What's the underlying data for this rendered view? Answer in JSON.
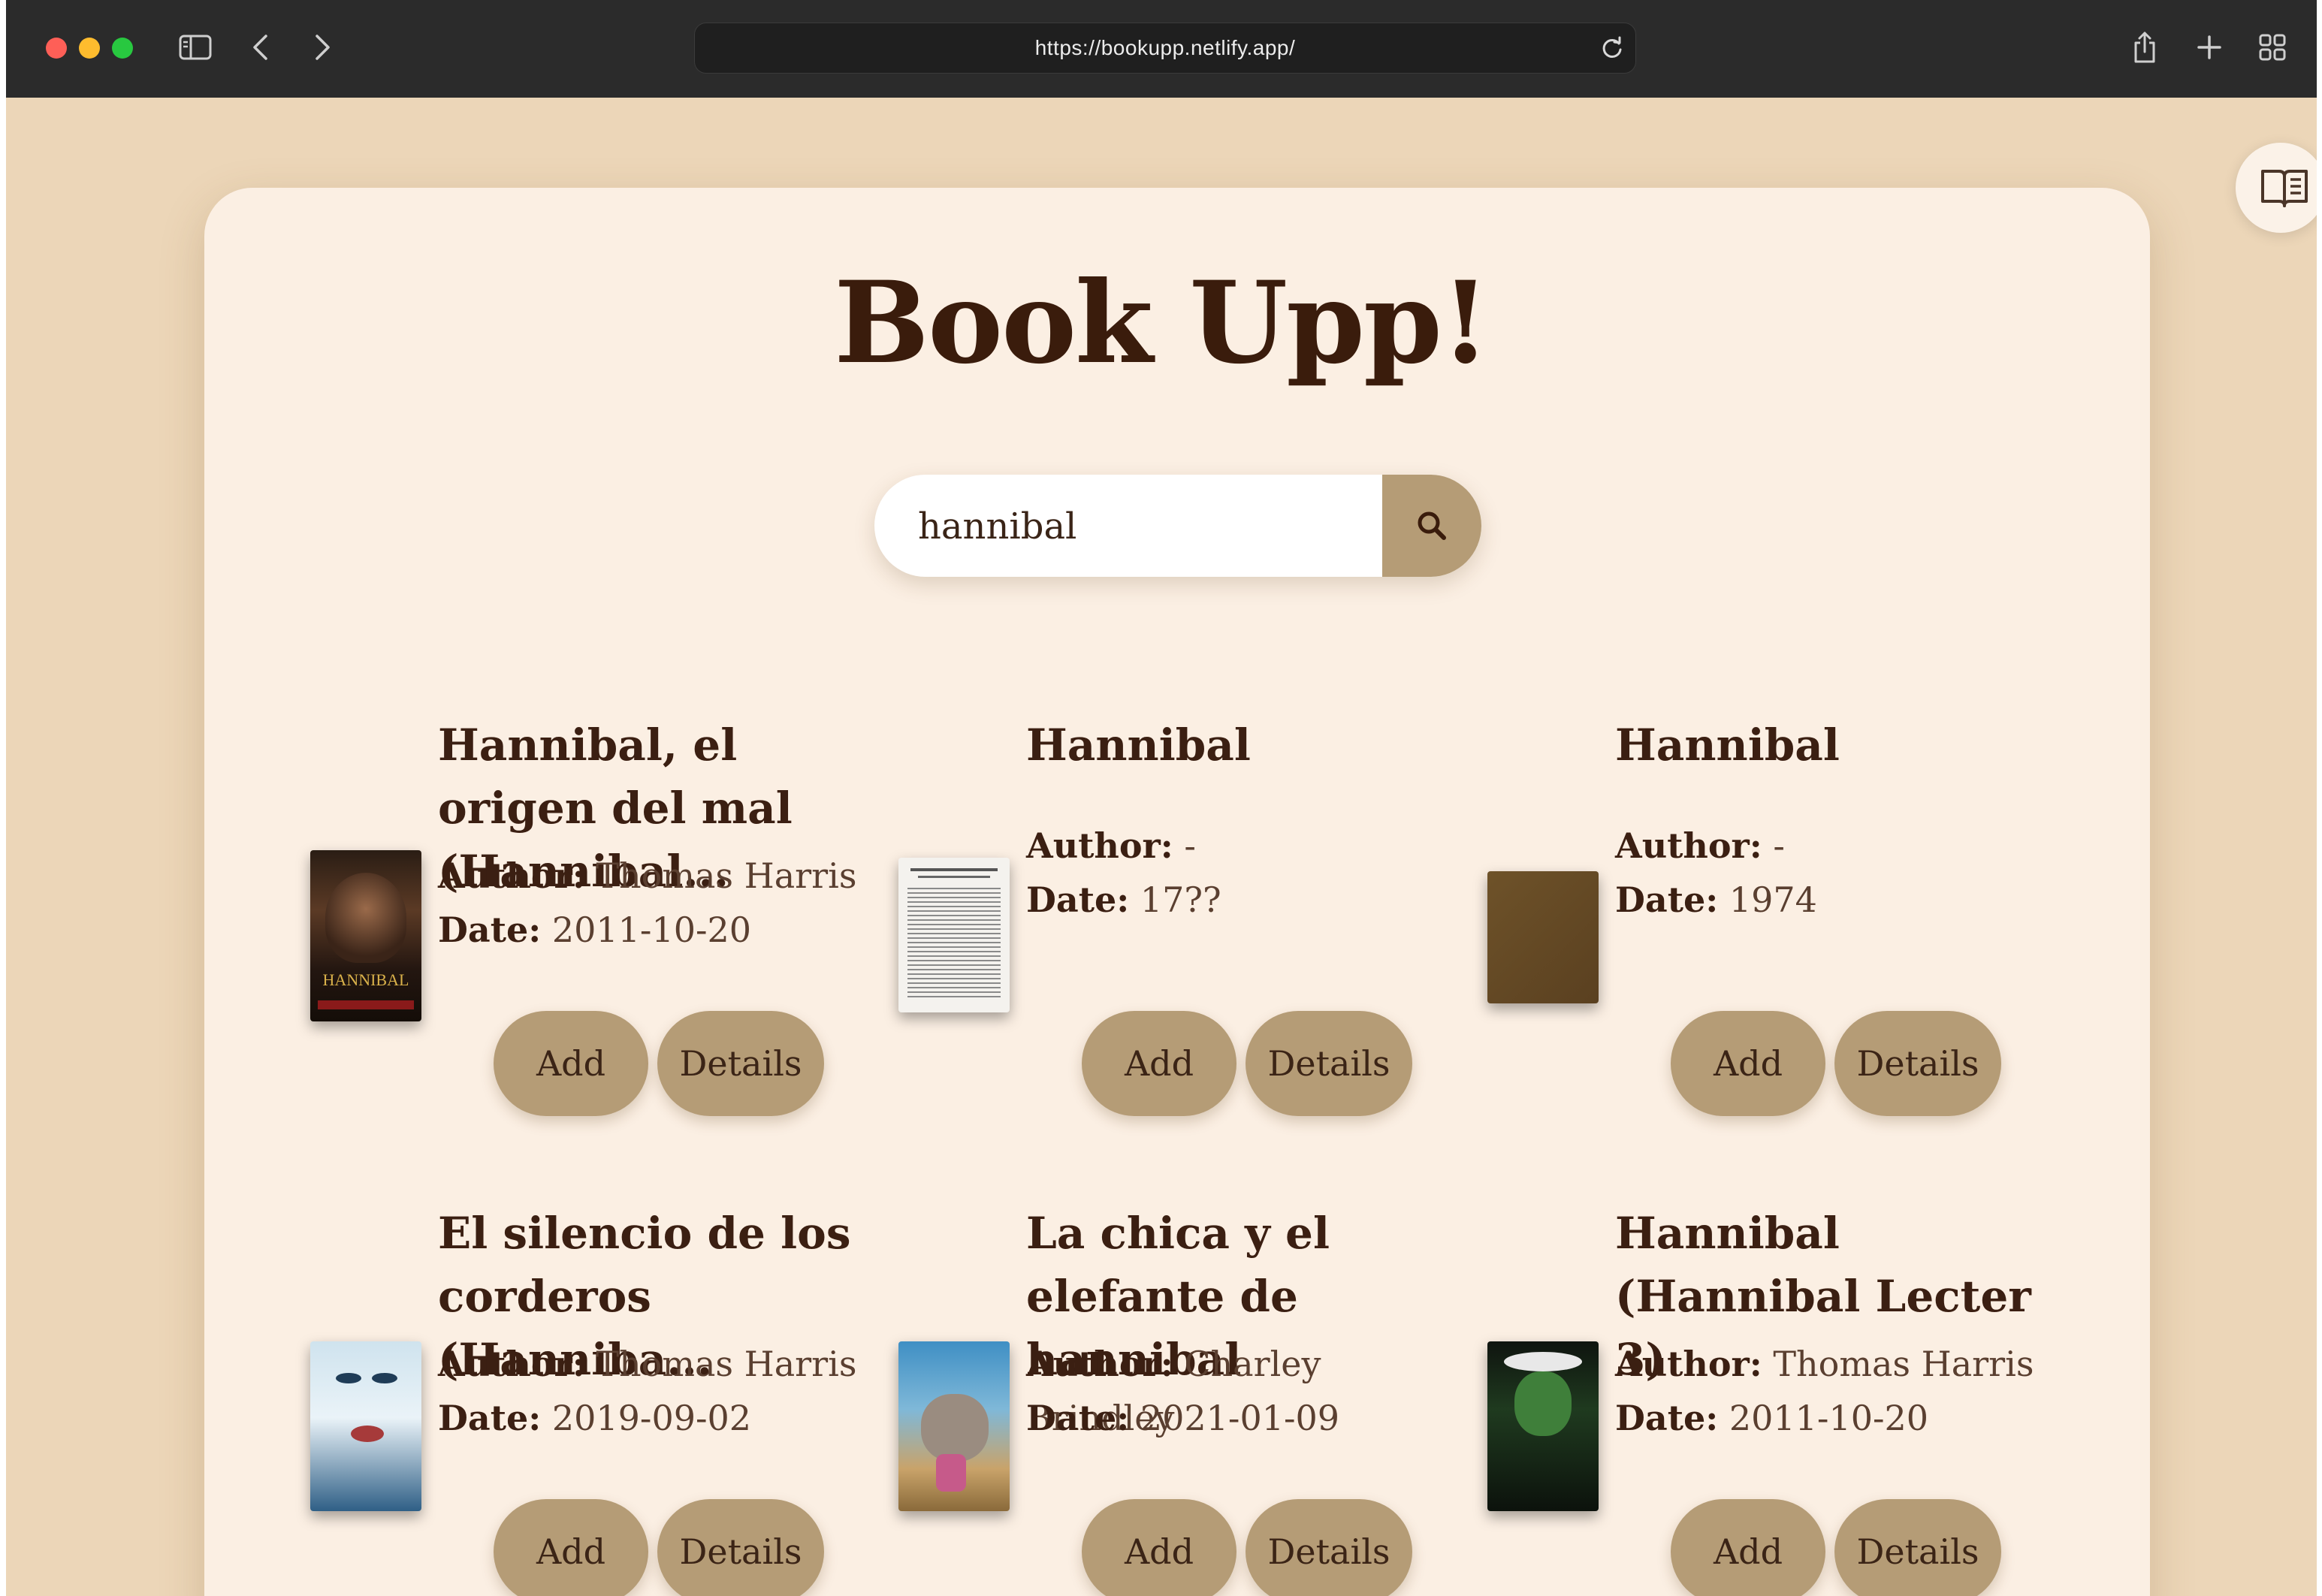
{
  "browser": {
    "url": "https://bookupp.netlify.app/",
    "icons": [
      "sidebar-icon",
      "back-icon",
      "forward-icon",
      "reload-icon",
      "share-icon",
      "new-tab-icon",
      "tab-overview-icon",
      "reader-icon"
    ]
  },
  "app": {
    "title": "Book Upp!",
    "search": {
      "value": "hannibal",
      "button_icon": "search-icon"
    },
    "colors": {
      "background": "#ecd6b8",
      "card": "#fbefe3",
      "button": "#b59c76",
      "text": "#3b1f12"
    }
  },
  "books": [
    {
      "title": "Hannibal, el origen del mal (Hannibal...",
      "author_label": "Author:",
      "author": "Thomas Harris",
      "date_label": "Date:",
      "date": "2011-10-20",
      "add_label": "Add",
      "details_label": "Details",
      "cover_text": "HANNIBAL"
    },
    {
      "title": "Hannibal",
      "author_label": "Author:",
      "author": "-",
      "date_label": "Date:",
      "date": "17??",
      "add_label": "Add",
      "details_label": "Details"
    },
    {
      "title": "Hannibal",
      "author_label": "Author:",
      "author": "-",
      "date_label": "Date:",
      "date": "1974",
      "add_label": "Add",
      "details_label": "Details"
    },
    {
      "title": "El silencio de los corderos (Hanniba...",
      "author_label": "Author:",
      "author": "Thomas Harris",
      "date_label": "Date:",
      "date": "2019-09-02",
      "add_label": "Add",
      "details_label": "Details"
    },
    {
      "title": "La chica y el elefante de hannibal",
      "author_label": "Author:",
      "author": "Charley Brindley",
      "date_label": "Date:",
      "date": "2021-01-09",
      "add_label": "Add",
      "details_label": "Details"
    },
    {
      "title": "Hannibal (Hannibal Lecter 3)",
      "author_label": "Author:",
      "author": "Thomas Harris",
      "date_label": "Date:",
      "date": "2011-10-20",
      "add_label": "Add",
      "details_label": "Details"
    }
  ]
}
